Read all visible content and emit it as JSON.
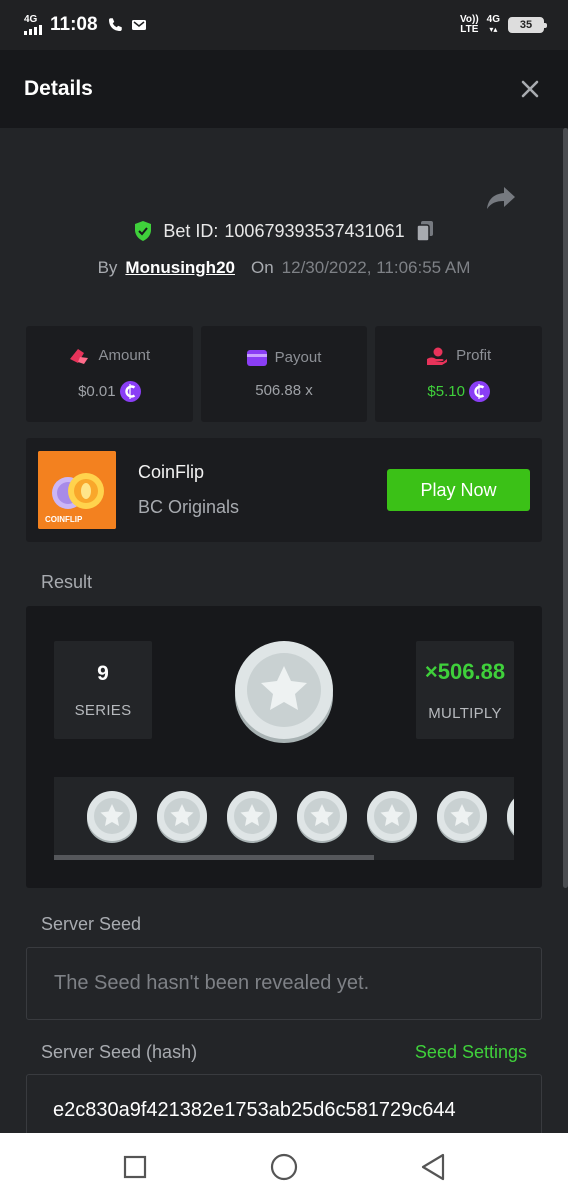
{
  "status_bar": {
    "network_left": "4G",
    "time": "11:08",
    "volte_top": "Vo))",
    "volte_bottom": "LTE",
    "network_right": "4G",
    "battery": "35"
  },
  "header": {
    "title": "Details"
  },
  "bet": {
    "label": "Bet ID:",
    "id": "100679393537431061",
    "by_label": "By",
    "username": "Monusingh20",
    "on_label": "On",
    "datetime": "12/30/2022, 11:06:55 AM"
  },
  "stats": {
    "amount": {
      "label": "Amount",
      "value": "$0.01"
    },
    "payout": {
      "label": "Payout",
      "value": "506.88 x"
    },
    "profit": {
      "label": "Profit",
      "value": "$5.10"
    }
  },
  "game": {
    "thumb_text": "COINFLIP",
    "name": "CoinFlip",
    "provider": "BC Originals",
    "play_label": "Play Now"
  },
  "result": {
    "section_label": "Result",
    "series_value": "9",
    "series_label": "SERIES",
    "multiply_value": "×506.88",
    "multiply_label": "MULTIPLY"
  },
  "server_seed": {
    "label": "Server Seed",
    "value": "The Seed hasn't been revealed yet."
  },
  "server_seed_hash": {
    "label": "Server Seed (hash)",
    "settings_label": "Seed Settings",
    "value": "e2c830a9f421382e1753ab25d6c581729c644"
  },
  "colors": {
    "accent_green": "#3fd03b",
    "coin_purple": "#8a3ef5",
    "background": "#232528",
    "panel": "#1b1c1f"
  }
}
